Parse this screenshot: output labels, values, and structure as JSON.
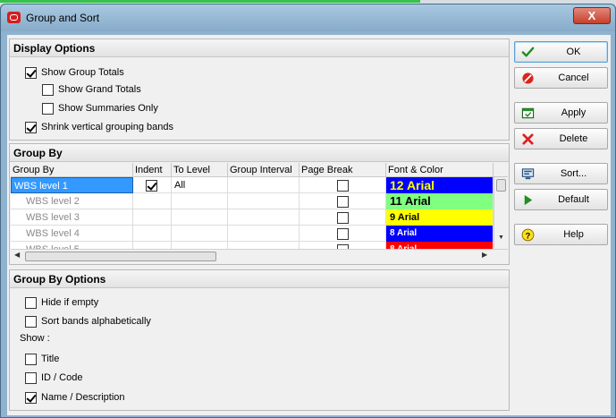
{
  "window": {
    "title": "Group and Sort",
    "close_label": "X"
  },
  "display_options": {
    "header": "Display Options",
    "items": [
      {
        "label": "Show Group Totals",
        "checked": true
      },
      {
        "label": "Show Grand Totals",
        "checked": false
      },
      {
        "label": "Show Summaries Only",
        "checked": false
      },
      {
        "label": "Shrink vertical grouping bands",
        "checked": true
      }
    ]
  },
  "group_by": {
    "header": "Group By",
    "columns": [
      "Group By",
      "Indent",
      "To Level",
      "Group Interval",
      "Page Break",
      "Font & Color"
    ],
    "rows": [
      {
        "group_by": "WBS level 1",
        "indent": true,
        "to_level": "All",
        "group_interval": "",
        "page_break": false,
        "font": "12 Arial",
        "bg": "#0000ff",
        "fg": "#ffff00",
        "selected": true
      },
      {
        "group_by": "WBS level 2",
        "indent": false,
        "to_level": "",
        "group_interval": "",
        "page_break": false,
        "font": "11 Arial",
        "bg": "#80ff80",
        "fg": "#000000",
        "selected": false
      },
      {
        "group_by": "WBS level 3",
        "indent": false,
        "to_level": "",
        "group_interval": "",
        "page_break": false,
        "font": "9 Arial",
        "bg": "#ffff00",
        "fg": "#000000",
        "selected": false
      },
      {
        "group_by": "WBS level 4",
        "indent": false,
        "to_level": "",
        "group_interval": "",
        "page_break": false,
        "font": "8 Arial",
        "bg": "#0000ff",
        "fg": "#ffffff",
        "selected": false
      },
      {
        "group_by": "WBS level 5",
        "indent": false,
        "to_level": "",
        "group_interval": "",
        "page_break": false,
        "font": "8 Arial",
        "bg": "#ff0000",
        "fg": "#ffffff",
        "selected": false
      }
    ]
  },
  "group_by_options": {
    "header": "Group By Options",
    "hide_if_empty": {
      "label": "Hide if empty",
      "checked": false
    },
    "sort_bands": {
      "label": "Sort bands alphabetically",
      "checked": false
    },
    "show_label": "Show :",
    "show_items": [
      {
        "label": "Title",
        "checked": false
      },
      {
        "label": "ID / Code",
        "checked": false
      },
      {
        "label": "Name / Description",
        "checked": true
      }
    ]
  },
  "buttons": {
    "ok": "OK",
    "cancel": "Cancel",
    "apply": "Apply",
    "delete": "Delete",
    "sort": "Sort...",
    "default": "Default",
    "help": "Help"
  },
  "icons": {
    "ok": "check-icon",
    "cancel": "no-entry-icon",
    "apply": "apply-window-icon",
    "delete": "red-x-icon",
    "sort": "sort-monitor-icon",
    "default": "play-arrow-icon",
    "help": "help-question-icon"
  },
  "colors": {
    "ok_green": "#1f8f1f",
    "cancel_red": "#d9261c",
    "delete_red": "#e02020",
    "selection_blue": "#3399ff"
  }
}
